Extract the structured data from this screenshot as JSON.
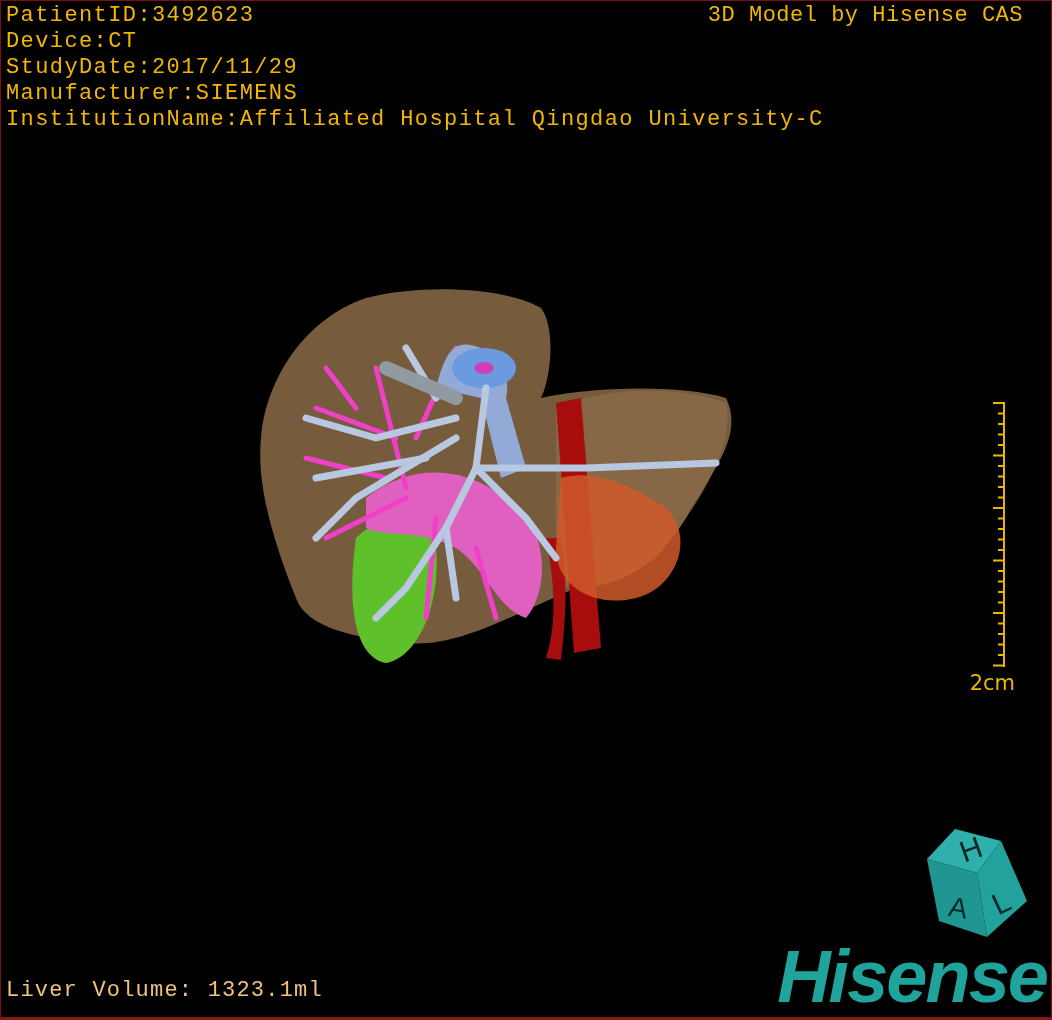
{
  "study_info": [
    "PatientID:3492623",
    "Device:CT",
    "StudyDate:2017/11/29",
    "Manufacturer:SIEMENS",
    "InstitutionName:Affiliated Hospital Qingdao University-C"
  ],
  "credit": "3D Model by Hisense CAS",
  "scale_bar": {
    "label": "2cm"
  },
  "measurement": "Liver Volume: 1323.1ml",
  "orientation_cube": {
    "faces": [
      "H",
      "A",
      "L"
    ]
  },
  "logo": "Hisense"
}
